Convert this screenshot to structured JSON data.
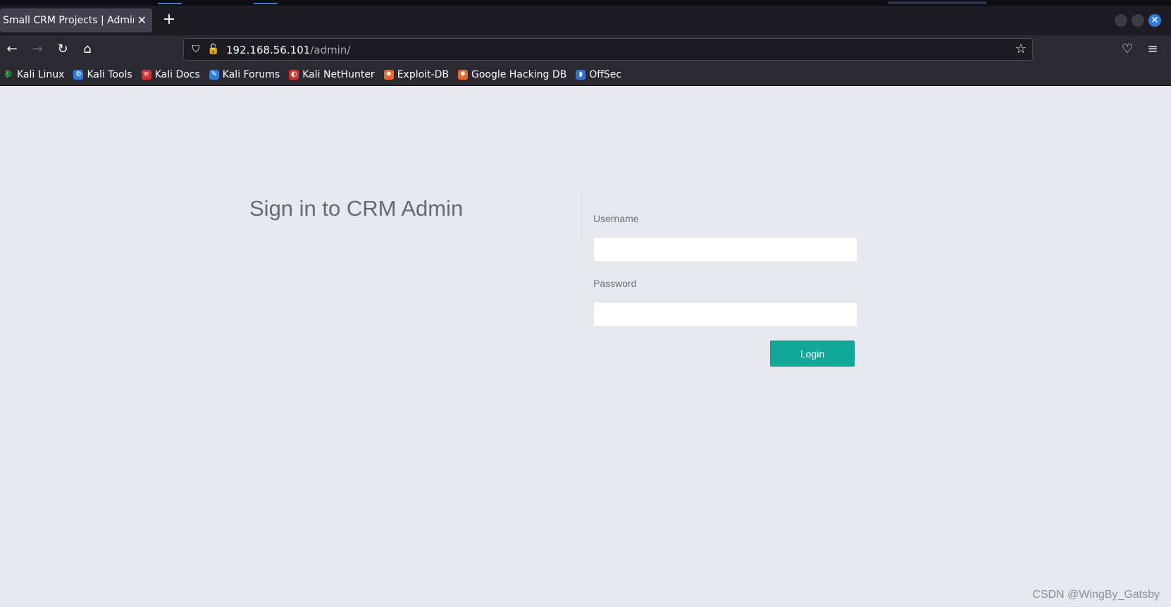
{
  "browser": {
    "tab_title": "Small CRM Projects | Admin L",
    "tab_close_glyph": "✕",
    "new_tab_glyph": "+",
    "url_host": "192.168.56.101",
    "url_path": "/admin/",
    "bookmarks": [
      {
        "label": "Kali Linux",
        "icon_color": "#2a2a2a",
        "icon_glyph": "🐉"
      },
      {
        "label": "Kali Tools",
        "icon_color": "#2f7de1",
        "icon_glyph": "⚙"
      },
      {
        "label": "Kali Docs",
        "icon_color": "#d33131",
        "icon_glyph": "≡"
      },
      {
        "label": "Kali Forums",
        "icon_color": "#2f7de1",
        "icon_glyph": "✎"
      },
      {
        "label": "Kali NetHunter",
        "icon_color": "#d33131",
        "icon_glyph": "◐"
      },
      {
        "label": "Exploit-DB",
        "icon_color": "#e8672a",
        "icon_glyph": "✸"
      },
      {
        "label": "Google Hacking DB",
        "icon_color": "#e8672a",
        "icon_glyph": "✸"
      },
      {
        "label": "OffSec",
        "icon_color": "#3a6fd5",
        "icon_glyph": "◗"
      }
    ]
  },
  "login": {
    "title": "Sign in to CRM Admin",
    "username_label": "Username",
    "password_label": "Password",
    "username_value": "",
    "password_value": "",
    "button_label": "Login",
    "accent_color": "#11a899"
  },
  "watermark": "CSDN @WingBy_Gatsby"
}
